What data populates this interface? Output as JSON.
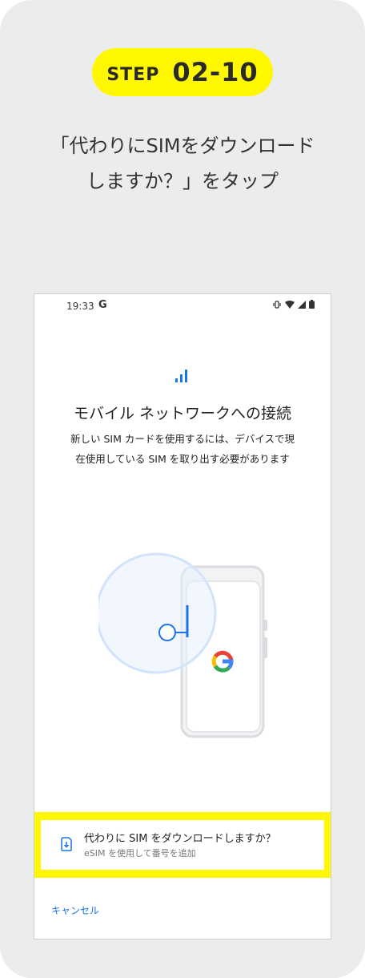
{
  "step": {
    "word": "STEP",
    "number": "02-10"
  },
  "instruction": {
    "line1": "「代わりにSIMをダウンロード",
    "line2": "しますか？」をタップ"
  },
  "status_bar": {
    "time": "19:33",
    "app_letter": "G"
  },
  "screen": {
    "title": "モバイル ネットワークへの接続",
    "description_line1": "新しい SIM カードを使用するには、デバイスで現",
    "description_line2": "在使用している SIM を取り出す必要があります"
  },
  "option": {
    "title": "代わりに SIM をダウンロードしますか？",
    "subtitle": "eSIM を使用して番号を追加"
  },
  "cancel_label": "キャンセル",
  "colors": {
    "highlight": "#fff800",
    "accent_blue": "#1a73e8",
    "background": "#ebecee"
  }
}
